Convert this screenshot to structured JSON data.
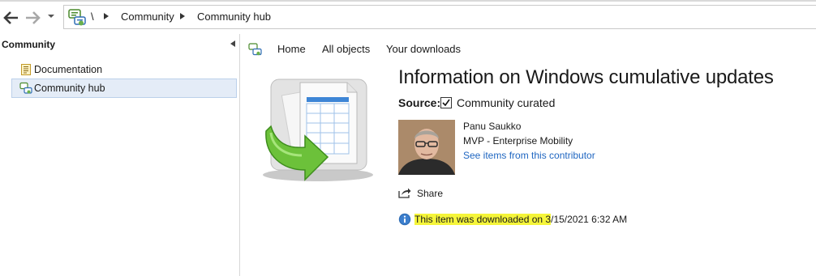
{
  "breadcrumb": {
    "root": "\\",
    "items": [
      "Community",
      "Community hub"
    ]
  },
  "left_pane": {
    "title": "Community",
    "items": [
      {
        "label": "Documentation",
        "icon": "document-icon",
        "selected": false
      },
      {
        "label": "Community hub",
        "icon": "community-hub-icon",
        "selected": true
      }
    ]
  },
  "tabs": [
    "Home",
    "All objects",
    "Your downloads"
  ],
  "item": {
    "title": "Information on Windows cumulative updates",
    "source_label": "Source:",
    "source_value": "Community curated",
    "source_checked": true
  },
  "contributor": {
    "name": "Panu Saukko",
    "role": "MVP - Enterprise Mobility",
    "link": "See items from this contributor"
  },
  "share_label": "Share",
  "download_info": {
    "highlighted": "This item was downloaded on ",
    "highlighted_tail": "3",
    "rest": "/15/2021 6:32 AM"
  },
  "colors": {
    "link": "#1f66c1",
    "highlight": "#f5f53a",
    "selection": "#e4ecf7"
  }
}
